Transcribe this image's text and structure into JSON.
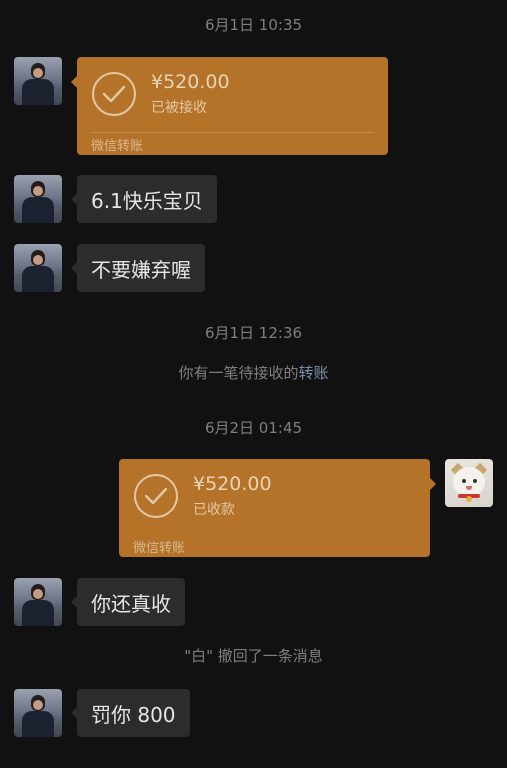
{
  "messages": {
    "ts1": "6月1日 10:35",
    "transfer1": {
      "amount": "¥520.00",
      "status": "已被接收",
      "footer": "微信转账"
    },
    "text1": "6.1快乐宝贝",
    "text2": "不要嫌弃喔",
    "ts2": "6月1日 12:36",
    "system1": {
      "text": "你有一笔待接收的",
      "link": "转账"
    },
    "ts3": "6月2日 01:45",
    "transfer2": {
      "amount": "¥520.00",
      "status": "已收款",
      "footer": "微信转账"
    },
    "text3": "你还真收",
    "recall": "\"白\" 撤回了一条消息",
    "text4": "罚你 800"
  },
  "colors": {
    "background": "#111111",
    "bubble": "#2c2c2c",
    "transfer_card": "#b5732a",
    "system_link": "#7d90a9"
  },
  "icons": {
    "transfer": "checkmark-circle-icon"
  }
}
